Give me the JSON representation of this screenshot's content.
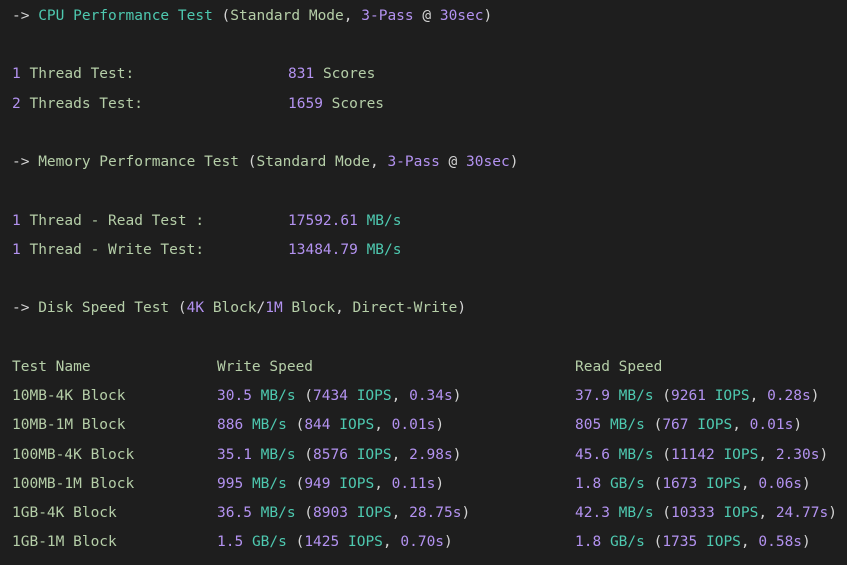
{
  "cpu": {
    "arrow": "->",
    "title": "CPU Performance Test",
    "mode_open": "(",
    "mode": "Standard Mode",
    "comma": ",",
    "passes": "3-Pass",
    "at": "@",
    "duration": "30sec",
    "mode_close": ")",
    "rows": [
      {
        "num": "1",
        "label": "Thread Test:",
        "value": "831",
        "unit": "Scores"
      },
      {
        "num": "2",
        "label": "Threads Test:",
        "value": "1659",
        "unit": "Scores"
      }
    ]
  },
  "memory": {
    "arrow": "->",
    "title": "Memory Performance Test",
    "mode": "Standard Mode",
    "passes": "3-Pass",
    "duration": "30sec",
    "rows": [
      {
        "num": "1",
        "label": "Thread - Read Test :",
        "value": "17592.61",
        "unit": "MB/s"
      },
      {
        "num": "1",
        "label": "Thread - Write Test:",
        "value": "13484.79",
        "unit": "MB/s"
      }
    ]
  },
  "disk": {
    "arrow": "->",
    "title": "Disk Speed Test",
    "block_a": "4K",
    "block_a_label": "Block",
    "block_b": "1M",
    "block_b_label": "Block",
    "write_mode": "Direct-Write",
    "headers": {
      "name": "Test Name",
      "write": "Write Speed",
      "read": "Read Speed"
    },
    "rows": [
      {
        "name": "10MB-4K Block",
        "w_val": "30.5",
        "w_unit": "MB/s",
        "w_iops": "7434",
        "w_time": "0.34s",
        "r_val": "37.9",
        "r_unit": "MB/s",
        "r_iops": "9261",
        "r_time": "0.28s"
      },
      {
        "name": "10MB-1M Block",
        "w_val": "886",
        "w_unit": "MB/s",
        "w_iops": "844",
        "w_time": "0.01s",
        "r_val": "805",
        "r_unit": "MB/s",
        "r_iops": "767",
        "r_time": "0.01s"
      },
      {
        "name": "100MB-4K Block",
        "w_val": "35.1",
        "w_unit": "MB/s",
        "w_iops": "8576",
        "w_time": "2.98s",
        "r_val": "45.6",
        "r_unit": "MB/s",
        "r_iops": "11142",
        "r_time": "2.30s"
      },
      {
        "name": "100MB-1M Block",
        "w_val": "995",
        "w_unit": "MB/s",
        "w_iops": "949",
        "w_time": "0.11s",
        "r_val": "1.8",
        "r_unit": "GB/s",
        "r_iops": "1673",
        "r_time": "0.06s"
      },
      {
        "name": "1GB-4K Block",
        "w_val": "36.5",
        "w_unit": "MB/s",
        "w_iops": "8903",
        "w_time": "28.75s",
        "r_val": "42.3",
        "r_unit": "MB/s",
        "r_iops": "10333",
        "r_time": "24.77s"
      },
      {
        "name": "1GB-1M Block",
        "w_val": "1.5",
        "w_unit": "GB/s",
        "w_iops": "1425",
        "w_time": "0.70s",
        "r_val": "1.8",
        "r_unit": "GB/s",
        "r_iops": "1735",
        "r_time": "0.58s"
      }
    ],
    "iops_label": "IOPS"
  }
}
